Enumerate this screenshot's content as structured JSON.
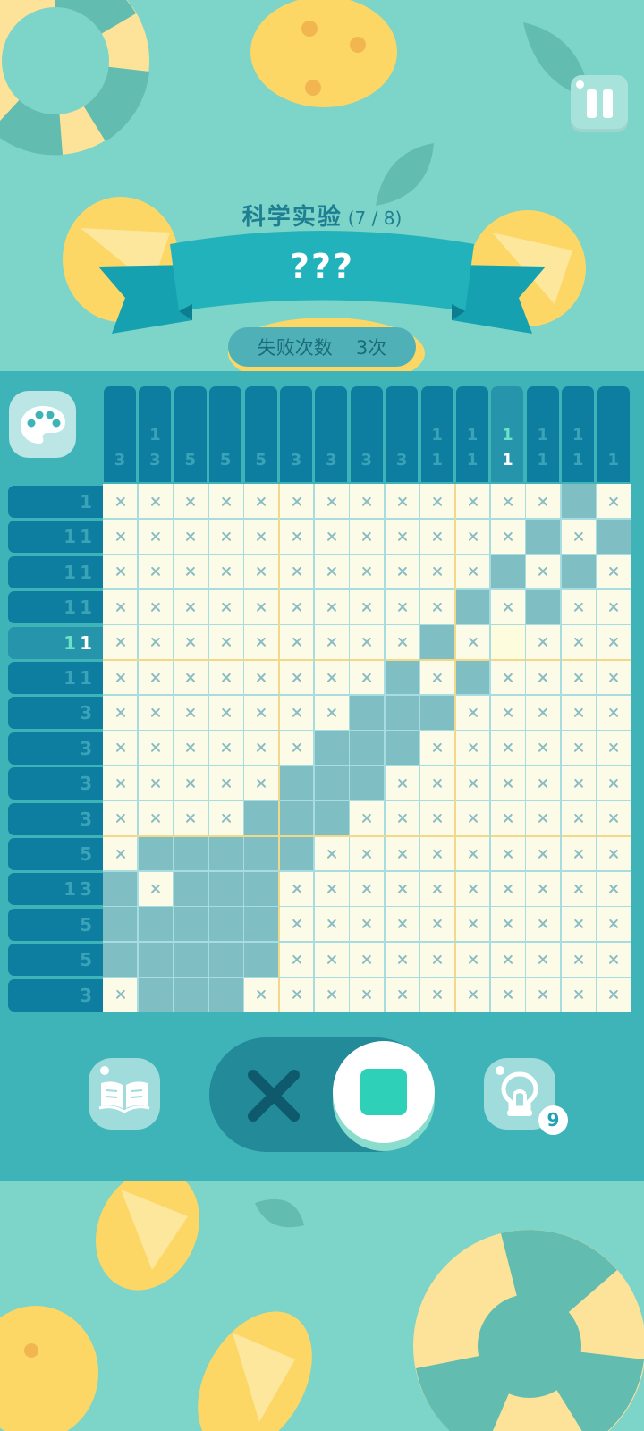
{
  "level": {
    "title": "科学实验",
    "progress": "(7 / 8)",
    "puzzle_name": "???"
  },
  "failures": {
    "label": "失败次数",
    "value": "3次"
  },
  "hint_count": "9",
  "colors": {
    "bg": "#7dd4c8",
    "board": "#3fb4b8",
    "clue": "#0d7ea0",
    "filled": "#7fbfc4",
    "cell": "#fbfbe8",
    "lemon": "#fcd766",
    "accent": "#2ed0b8"
  },
  "icons": {
    "pause": "pause-icon",
    "palette": "palette-icon",
    "book": "book-icon",
    "hint": "lightbulb-icon",
    "mode_cross": "cross-icon",
    "mode_fill": "square-icon"
  },
  "puzzle": {
    "size": 15,
    "highlight": {
      "row": 4,
      "col": 11
    },
    "column_clues": [
      [
        "3"
      ],
      [
        "1",
        "3"
      ],
      [
        "5"
      ],
      [
        "5"
      ],
      [
        "5"
      ],
      [
        "3"
      ],
      [
        "3"
      ],
      [
        "3"
      ],
      [
        "3"
      ],
      [
        "1",
        "1"
      ],
      [
        "1",
        "1"
      ],
      [
        "1",
        "1"
      ],
      [
        "1",
        "1"
      ],
      [
        "1",
        "1"
      ],
      [
        "1"
      ]
    ],
    "row_clues": [
      [
        "1"
      ],
      [
        "1",
        "1"
      ],
      [
        "1",
        "1"
      ],
      [
        "1",
        "1"
      ],
      [
        "1",
        "1"
      ],
      [
        "1",
        "1"
      ],
      [
        "3"
      ],
      [
        "3"
      ],
      [
        "3"
      ],
      [
        "3"
      ],
      [
        "5"
      ],
      [
        "1",
        "3"
      ],
      [
        "5"
      ],
      [
        "5"
      ],
      [
        "3"
      ]
    ],
    "grid": [
      "xxxxxxxxxxxxxfx",
      "xxxxxxxxxxxxfxf",
      "xxxxxxxxxxxfxfx",
      "xxxxxxxxxxfxfxx",
      "xxxxxxxxxfx.xxx",
      "xxxxxxxxfxfxxxx",
      "xxxxxxxfffxxxxx",
      "xxxxxxfffxxxxxx",
      "xxxxxfffxxxxxxx",
      "xxxxfffxxxxxxxx",
      "xfffffxxxxxxxxx",
      "fxfffxxxxxxxxxx",
      "fffffxxxxxxxxxx",
      "fffffxxxxxxxxxx",
      "xfffxxxxxxxxxxx"
    ]
  }
}
